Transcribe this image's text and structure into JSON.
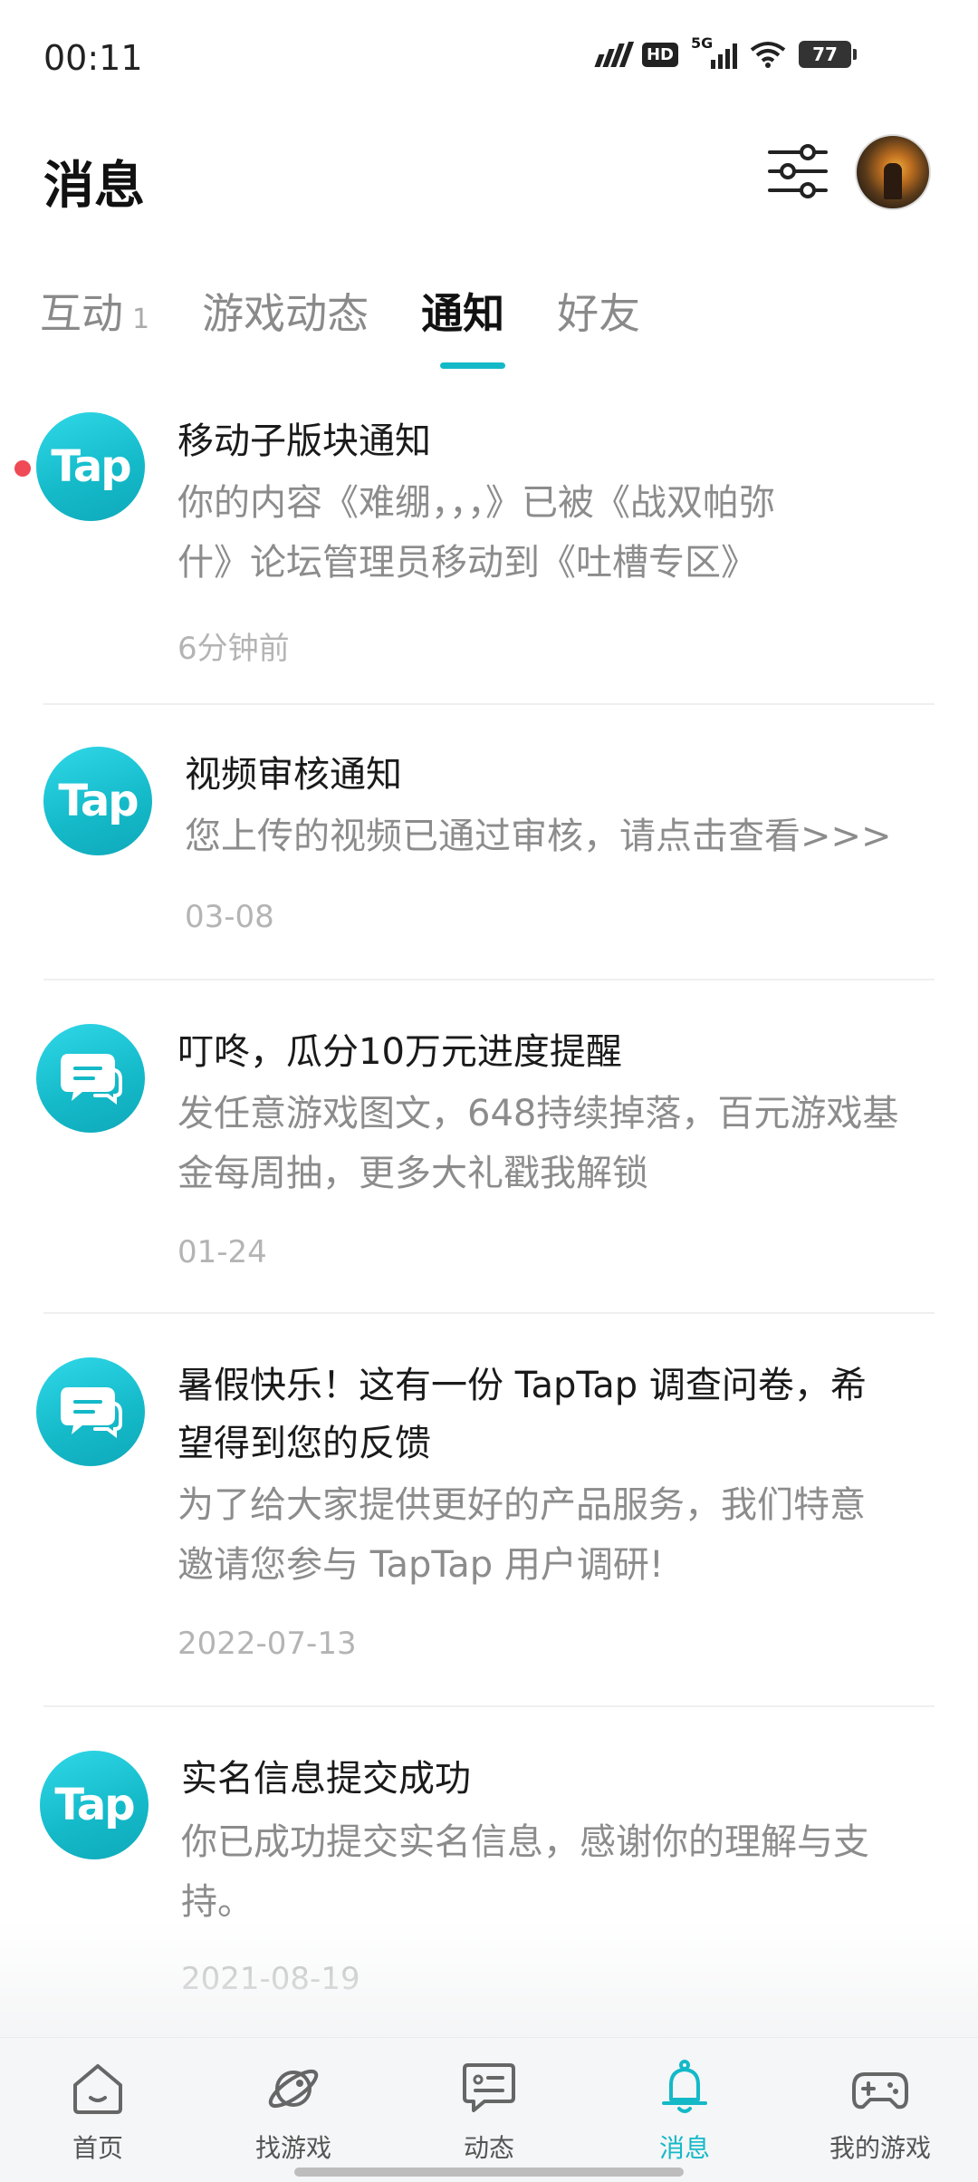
{
  "status_bar": {
    "time": "00:11",
    "hd": "HD",
    "network": "5G",
    "battery": "77"
  },
  "header": {
    "title": "消息"
  },
  "tabs": [
    {
      "label": "互动",
      "count": "1",
      "active": false
    },
    {
      "label": "游戏动态",
      "active": false
    },
    {
      "label": "通知",
      "active": true
    },
    {
      "label": "好友",
      "active": false
    }
  ],
  "notifications": [
    {
      "icon": "taptap-logo",
      "icon_text": "Tap",
      "title": "移动子版块通知",
      "body_lines": [
        "你的内容《难绷，，，》已被《战双帕弥",
        "什》论坛管理员移动到《吐槽专区》"
      ],
      "time": "6分钟前",
      "unread": true
    },
    {
      "icon": "taptap-logo",
      "icon_text": "Tap",
      "title": "视频审核通知",
      "body_lines": [
        "您上传的视频已通过审核，请点击查看>>>"
      ],
      "time": "03-08",
      "unread": false
    },
    {
      "icon": "chat-bubble-icon",
      "title": "叮咚，瓜分10万元进度提醒",
      "body_lines": [
        "发任意游戏图文，648持续掉落，百元游戏基",
        "金每周抽，更多大礼戳我解锁"
      ],
      "time": "01-24",
      "unread": false
    },
    {
      "icon": "chat-bubble-icon",
      "title_lines": [
        "暑假快乐！这有一份 TapTap 调查问卷，希",
        "望得到您的反馈"
      ],
      "body_lines": [
        "为了给大家提供更好的产品服务，我们特意",
        "邀请您参与 TapTap 用户调研!"
      ],
      "time": "2022-07-13",
      "unread": false
    },
    {
      "icon": "taptap-logo",
      "icon_text": "Tap",
      "title": "实名信息提交成功",
      "body_lines": [
        "你已成功提交实名信息，感谢你的理解与支",
        "持。"
      ],
      "time": "2021-08-19",
      "unread": false
    }
  ],
  "bottom_nav": [
    {
      "label": "首页",
      "icon": "home-icon",
      "active": false
    },
    {
      "label": "找游戏",
      "icon": "planet-icon",
      "active": false
    },
    {
      "label": "动态",
      "icon": "feed-icon",
      "active": false
    },
    {
      "label": "消息",
      "icon": "bell-icon",
      "active": true
    },
    {
      "label": "我的游戏",
      "icon": "gamepad-icon",
      "active": false
    }
  ],
  "colors": {
    "accent": "#14b9c8",
    "unread_dot": "#ef4a55"
  }
}
